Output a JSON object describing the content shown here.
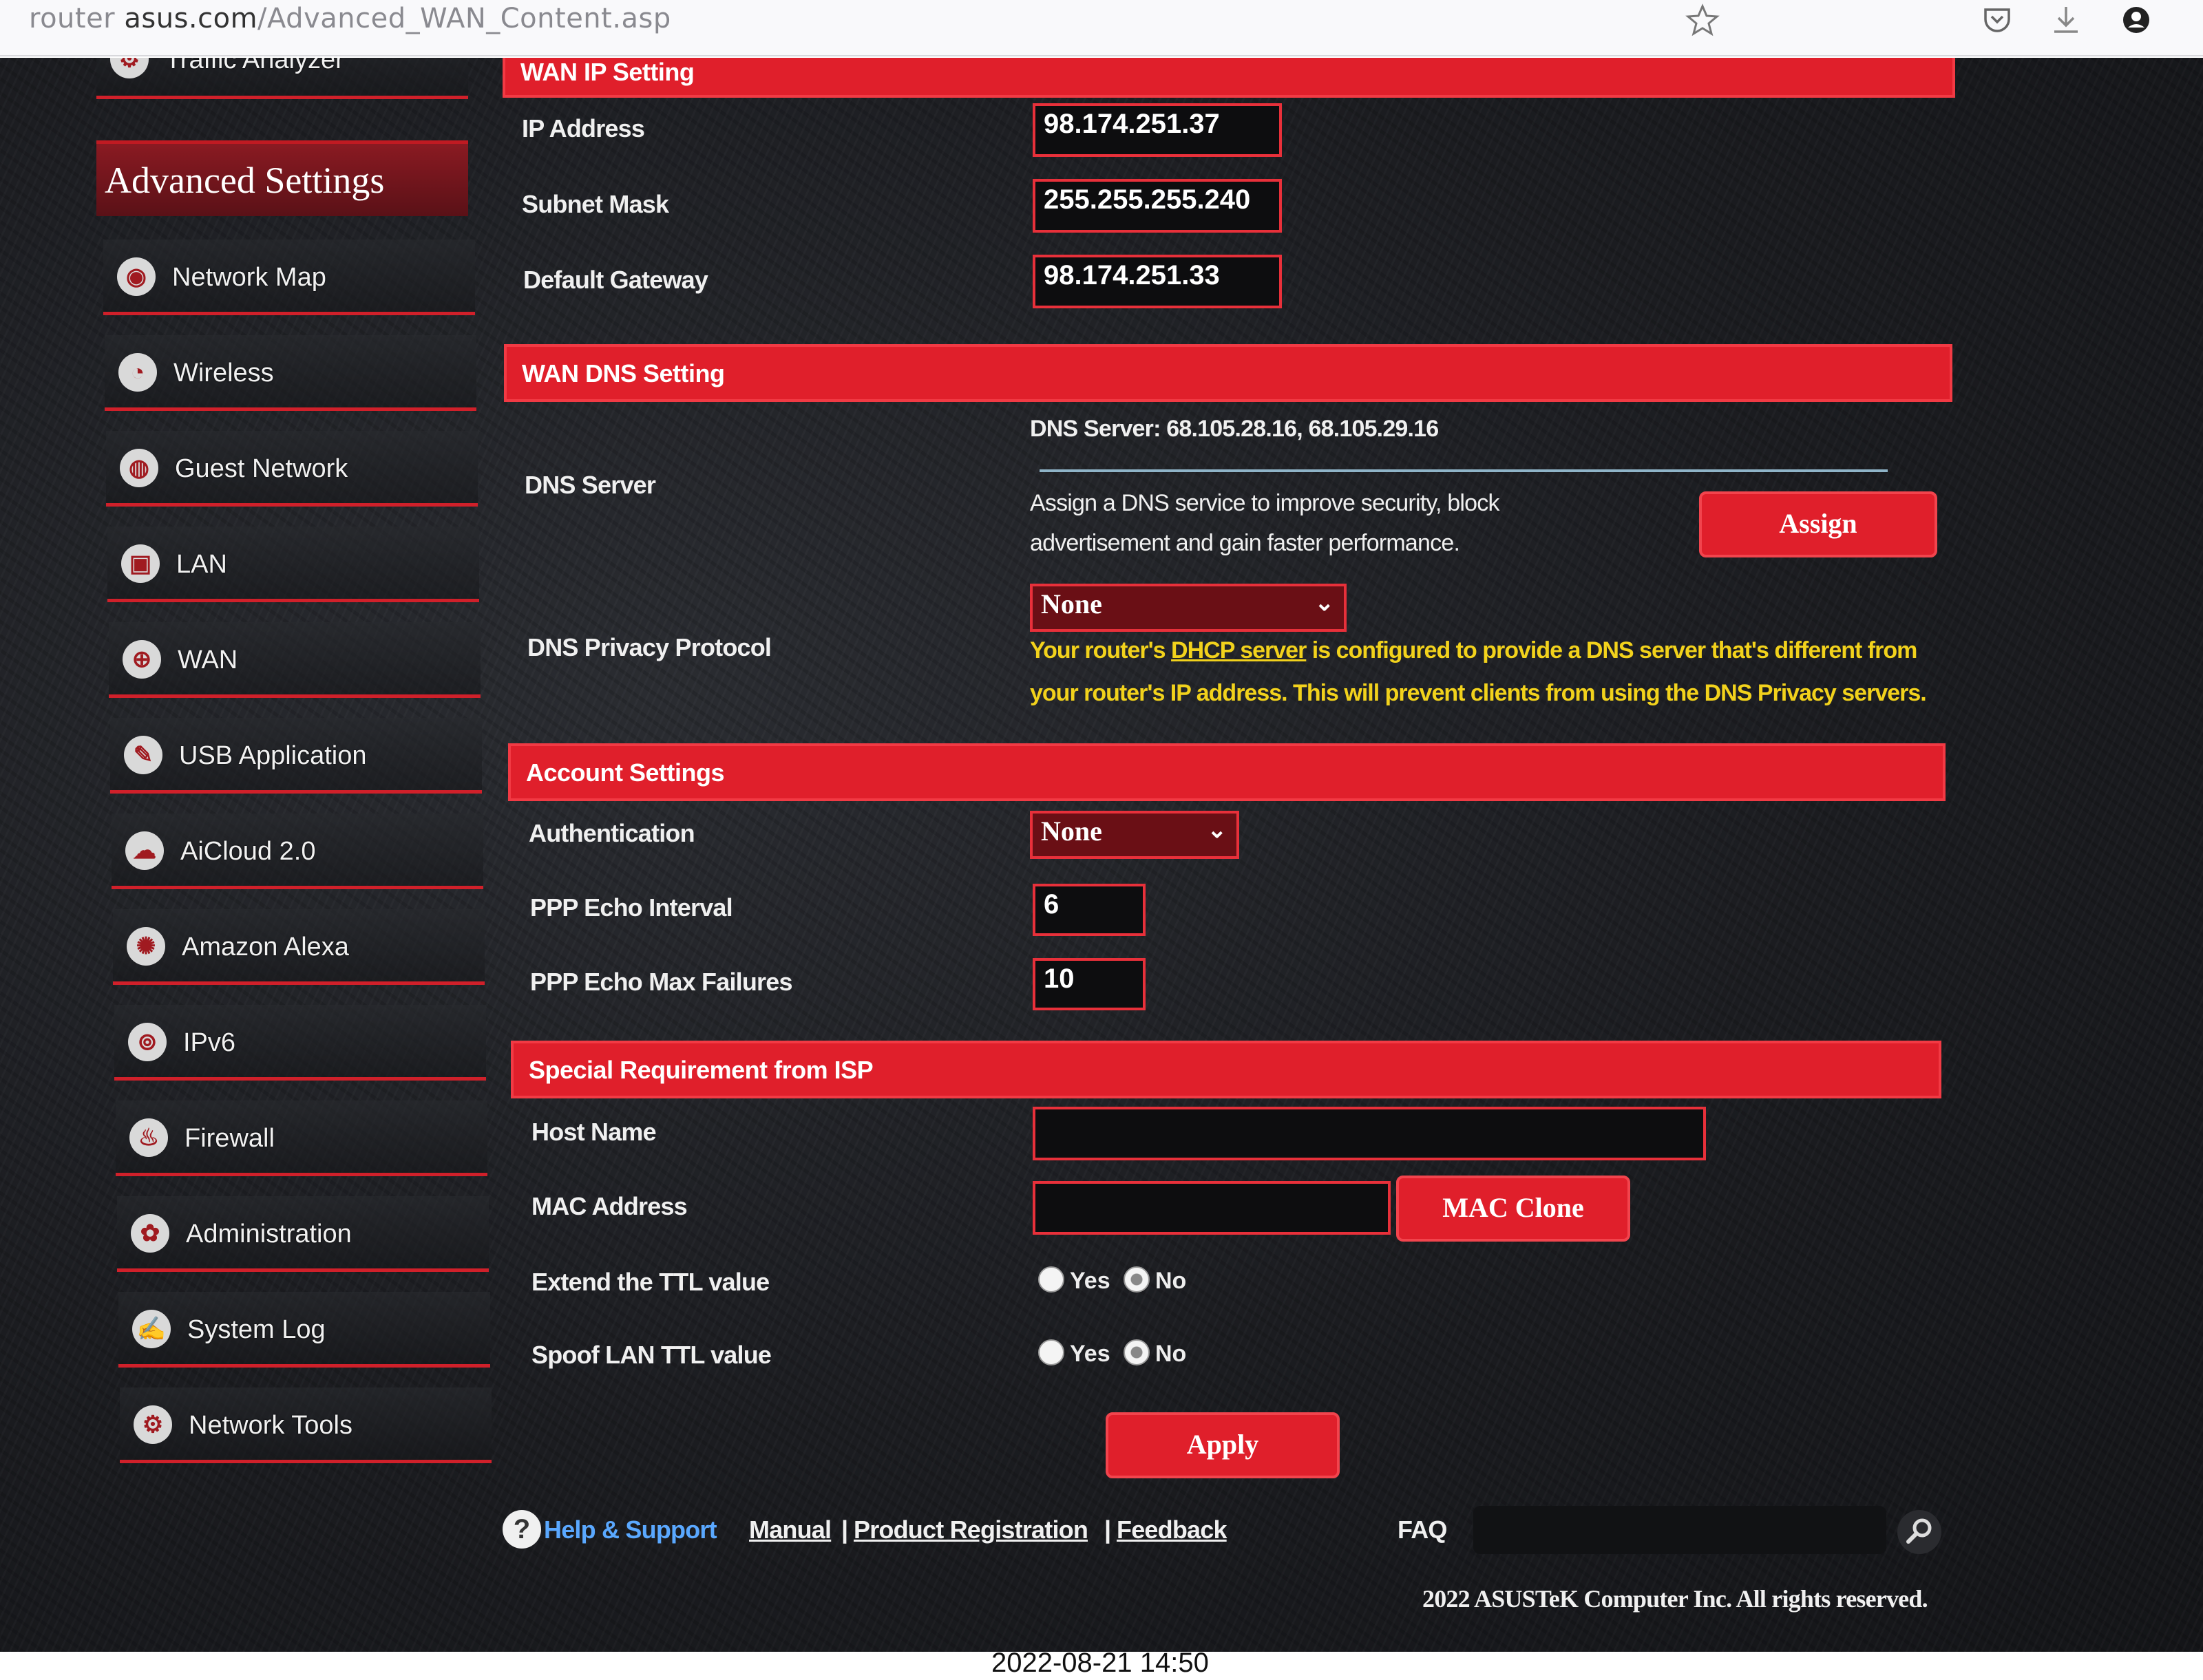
{
  "browser": {
    "url_host": "router",
    "url_path_domain": "asus.com",
    "url_path": "/Advanced_WAN_Content.asp",
    "icons": [
      "bookmark-star-icon",
      "pocket-icon",
      "download-icon",
      "profile-icon"
    ]
  },
  "sidebar": {
    "traffic_analyzer": "Traffic Analyzer",
    "header": "Advanced Settings",
    "items": [
      {
        "label": "Network Map",
        "icon": "network-map-icon"
      },
      {
        "label": "Wireless",
        "icon": "wireless-icon"
      },
      {
        "label": "Guest Network",
        "icon": "guest-network-icon"
      },
      {
        "label": "LAN",
        "icon": "lan-icon"
      },
      {
        "label": "WAN",
        "icon": "wan-globe-icon"
      },
      {
        "label": "USB Application",
        "icon": "usb-icon"
      },
      {
        "label": "AiCloud 2.0",
        "icon": "cloud-icon"
      },
      {
        "label": "Amazon Alexa",
        "icon": "alexa-icon"
      },
      {
        "label": "IPv6",
        "icon": "ipv6-icon"
      },
      {
        "label": "Firewall",
        "icon": "firewall-icon"
      },
      {
        "label": "Administration",
        "icon": "admin-gear-icon"
      },
      {
        "label": "System Log",
        "icon": "system-log-icon"
      },
      {
        "label": "Network Tools",
        "icon": "network-tools-icon"
      }
    ]
  },
  "wan_ip": {
    "title": "WAN IP Setting",
    "ip_label": "IP Address",
    "ip_value": "98.174.251.37",
    "subnet_label": "Subnet Mask",
    "subnet_value": "255.255.255.240",
    "gateway_label": "Default Gateway",
    "gateway_value": "98.174.251.33"
  },
  "wan_dns": {
    "title": "WAN DNS Setting",
    "dns_server_label": "DNS Server",
    "dns_server_value": "DNS Server: 68.105.28.16, 68.105.29.16",
    "assign_desc_1": "Assign a DNS service to improve security, block",
    "assign_desc_2": "advertisement and gain faster performance.",
    "assign_button": "Assign",
    "privacy_label": "DNS Privacy Protocol",
    "privacy_value": "None",
    "warn_1a": "Your router's ",
    "warn_link": "DHCP server",
    "warn_1b": " is configured to provide a DNS server that's different from",
    "warn_2": "your router's IP address. This will prevent clients from using the DNS Privacy servers."
  },
  "account": {
    "title": "Account Settings",
    "auth_label": "Authentication",
    "auth_value": "None",
    "echo_interval_label": "PPP Echo Interval",
    "echo_interval_value": "6",
    "echo_max_label": "PPP Echo Max Failures",
    "echo_max_value": "10"
  },
  "isp": {
    "title": "Special Requirement from ISP",
    "host_label": "Host Name",
    "host_value": "",
    "mac_label": "MAC Address",
    "mac_value": "",
    "mac_clone_button": "MAC Clone",
    "ttl_label": "Extend the TTL value",
    "spoof_label": "Spoof LAN TTL value",
    "yes": "Yes",
    "no": "No",
    "ttl_selected": "No",
    "spoof_selected": "No"
  },
  "apply_button": "Apply",
  "footer": {
    "help": "Help & Support",
    "manual": "Manual",
    "product_reg": "Product Registration",
    "feedback": "Feedback",
    "sep": "|",
    "faq": "FAQ",
    "faq_placeholder": "",
    "copyright": "2022 ASUSTeK Computer Inc. All rights reserved."
  },
  "timestamp": "2022-08-21 14:50",
  "colors": {
    "accent": "#e01f2b",
    "warning": "#f2d21c",
    "background": "#1b1c20"
  }
}
